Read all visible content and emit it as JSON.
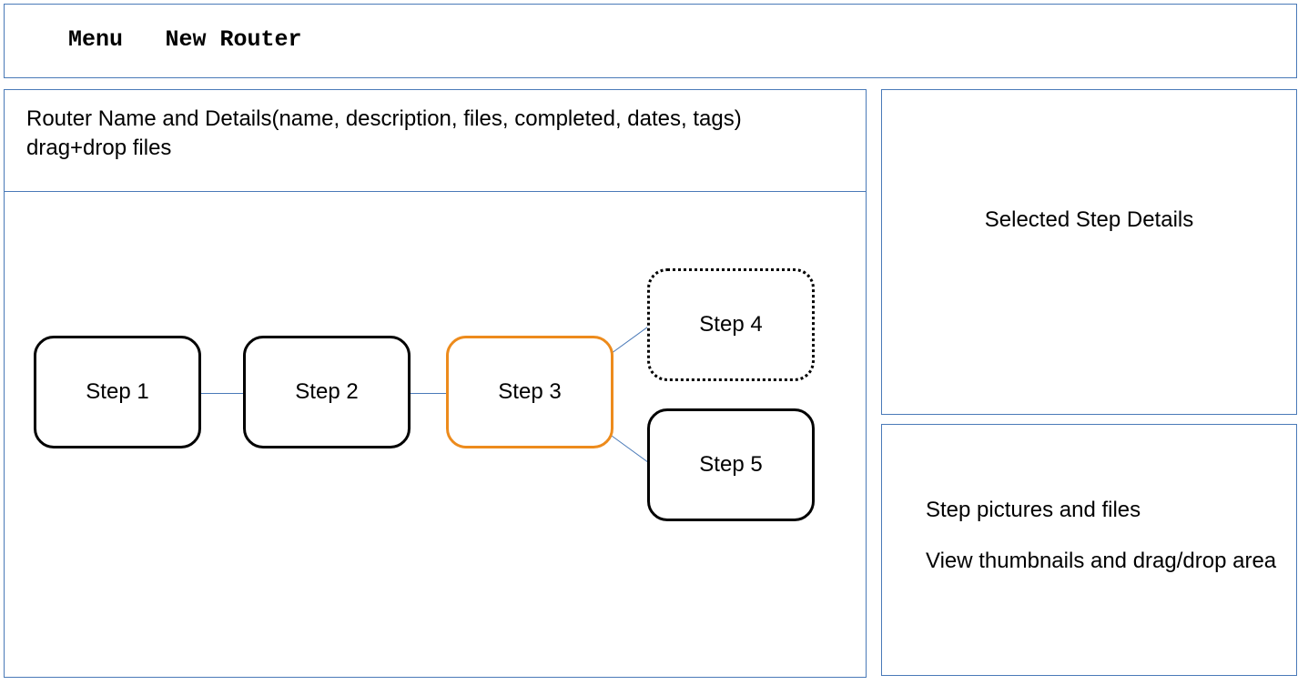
{
  "header": {
    "menu_label": "Menu",
    "title": "New Router"
  },
  "main": {
    "router_details": "Router Name and Details(name, description, files, completed, dates, tags) drag+drop files",
    "steps": {
      "s1": "Step 1",
      "s2": "Step 2",
      "s3": "Step 3",
      "s4": "Step 4",
      "s5": "Step 5"
    }
  },
  "right": {
    "details_title": "Selected Step Details",
    "files_line1": "Step pictures and files",
    "files_line2": "View thumbnails and drag/drop area"
  }
}
